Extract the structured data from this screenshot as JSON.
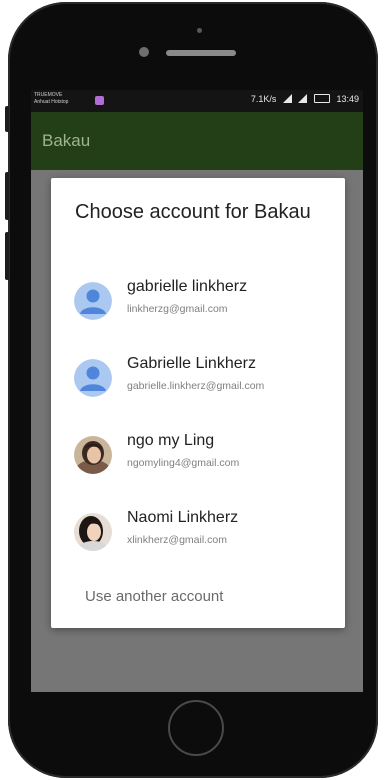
{
  "status_bar": {
    "carrier_line1": "TRUEMOVE",
    "carrier_line2": "Anhuat Hotstop",
    "speed": "7.1K/s",
    "time": "13:49"
  },
  "app_bar": {
    "title": "Bakau"
  },
  "dialog": {
    "title": "Choose account for Bakau",
    "accounts": [
      {
        "name": "gabrielle linkherz",
        "email": "linkherzg@gmail.com",
        "avatar": "default-person-icon"
      },
      {
        "name": "Gabrielle Linkherz",
        "email": "gabrielle.linkherz@gmail.com",
        "avatar": "default-person-icon"
      },
      {
        "name": "ngo my Ling",
        "email": "ngomyling4@gmail.com",
        "avatar": "profile-photo"
      },
      {
        "name": "Naomi Linkherz",
        "email": "xlinkherz@gmail.com",
        "avatar": "profile-photo"
      }
    ],
    "use_another": "Use another account"
  },
  "colors": {
    "app_bar": "#223f18",
    "default_avatar_bg": "#aac8f0",
    "default_avatar_fg": "#4f86dc",
    "scrim": "#767676"
  }
}
